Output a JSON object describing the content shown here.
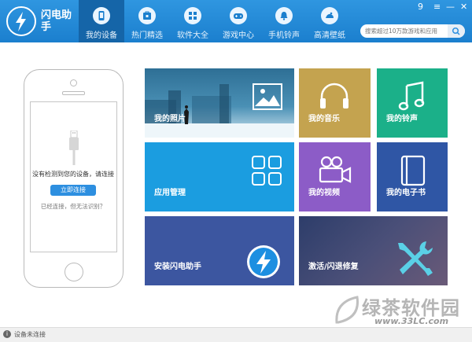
{
  "app": {
    "logo_text": "闪电助手",
    "window_controls": [
      "9",
      "≡",
      "—",
      "✕"
    ]
  },
  "nav": {
    "items": [
      {
        "label": "我的设备",
        "icon": "phone-icon",
        "active": true
      },
      {
        "label": "热门精选",
        "icon": "store-icon",
        "active": false
      },
      {
        "label": "软件大全",
        "icon": "apps-grid-icon",
        "active": false
      },
      {
        "label": "游戏中心",
        "icon": "gamepad-icon",
        "active": false
      },
      {
        "label": "手机铃声",
        "icon": "bell-icon",
        "active": false
      },
      {
        "label": "高清壁纸",
        "icon": "wallpaper-icon",
        "active": false
      }
    ]
  },
  "search": {
    "placeholder": "搜索超过10万款游戏和应用"
  },
  "device": {
    "status_text": "没有检测到您的设备，请连接",
    "connect_label": "立即连接",
    "cannot_recognize": "已经连接，但无法识别？"
  },
  "tiles": {
    "photos": {
      "label": "我的照片",
      "color": "#3a7fa6"
    },
    "music": {
      "label": "我的音乐",
      "color": "#c4a34f"
    },
    "ringtone": {
      "label": "我的铃声",
      "color": "#1bb089"
    },
    "apps": {
      "label": "应用管理",
      "color": "#1b9de0"
    },
    "video": {
      "label": "我的视频",
      "color": "#8c5cc7"
    },
    "ebook": {
      "label": "我的电子书",
      "color": "#2f56a5"
    },
    "install": {
      "label": "安装闪电助手",
      "color": "#3c56a0"
    },
    "repair": {
      "label": "激活/闪退修复",
      "color": "#3b4a7a"
    }
  },
  "status_bar": {
    "text": "设备未连接"
  },
  "watermark": {
    "main": "绿茶软件园",
    "url": "www.33LC.com"
  }
}
